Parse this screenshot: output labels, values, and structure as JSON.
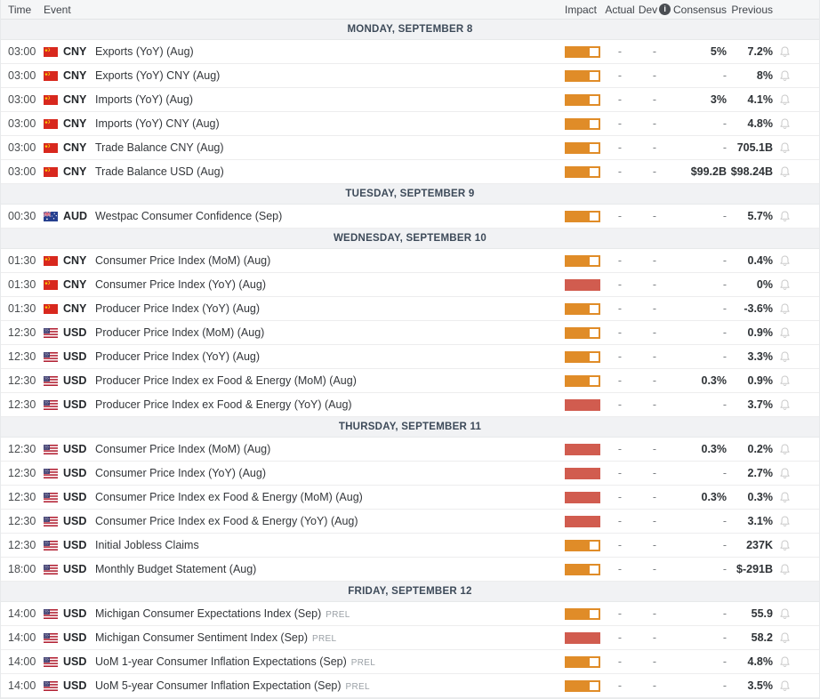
{
  "columns": {
    "time": "Time",
    "event": "Event",
    "impact": "Impact",
    "actual": "Actual",
    "dev": "Dev",
    "consensus": "Consensus",
    "previous": "Previous"
  },
  "colors": {
    "impact_medium": "#e08c28",
    "impact_high": "#d15c4f",
    "day_band_bg": "#f1f2f4",
    "day_band_text": "#3d4a59"
  },
  "sections": [
    {
      "label": "MONDAY, SEPTEMBER 8",
      "rows": [
        {
          "time": "03:00",
          "currency": "CNY",
          "flag": "cn",
          "event": "Exports (YoY) (Aug)",
          "impact": "medium",
          "actual": "-",
          "dev": "-",
          "consensus": "5%",
          "previous": "7.2%"
        },
        {
          "time": "03:00",
          "currency": "CNY",
          "flag": "cn",
          "event": "Exports (YoY) CNY (Aug)",
          "impact": "medium",
          "actual": "-",
          "dev": "-",
          "consensus": "-",
          "previous": "8%"
        },
        {
          "time": "03:00",
          "currency": "CNY",
          "flag": "cn",
          "event": "Imports (YoY) (Aug)",
          "impact": "medium",
          "actual": "-",
          "dev": "-",
          "consensus": "3%",
          "previous": "4.1%"
        },
        {
          "time": "03:00",
          "currency": "CNY",
          "flag": "cn",
          "event": "Imports (YoY) CNY (Aug)",
          "impact": "medium",
          "actual": "-",
          "dev": "-",
          "consensus": "-",
          "previous": "4.8%"
        },
        {
          "time": "03:00",
          "currency": "CNY",
          "flag": "cn",
          "event": "Trade Balance CNY (Aug)",
          "impact": "medium",
          "actual": "-",
          "dev": "-",
          "consensus": "-",
          "previous": "705.1B"
        },
        {
          "time": "03:00",
          "currency": "CNY",
          "flag": "cn",
          "event": "Trade Balance USD (Aug)",
          "impact": "medium",
          "actual": "-",
          "dev": "-",
          "consensus": "$99.2B",
          "previous": "$98.24B"
        }
      ]
    },
    {
      "label": "TUESDAY, SEPTEMBER 9",
      "rows": [
        {
          "time": "00:30",
          "currency": "AUD",
          "flag": "au",
          "event": "Westpac Consumer Confidence (Sep)",
          "impact": "medium",
          "actual": "-",
          "dev": "-",
          "consensus": "-",
          "previous": "5.7%"
        }
      ]
    },
    {
      "label": "WEDNESDAY, SEPTEMBER 10",
      "rows": [
        {
          "time": "01:30",
          "currency": "CNY",
          "flag": "cn",
          "event": "Consumer Price Index (MoM) (Aug)",
          "impact": "medium",
          "actual": "-",
          "dev": "-",
          "consensus": "-",
          "previous": "0.4%"
        },
        {
          "time": "01:30",
          "currency": "CNY",
          "flag": "cn",
          "event": "Consumer Price Index (YoY) (Aug)",
          "impact": "high",
          "actual": "-",
          "dev": "-",
          "consensus": "-",
          "previous": "0%"
        },
        {
          "time": "01:30",
          "currency": "CNY",
          "flag": "cn",
          "event": "Producer Price Index (YoY) (Aug)",
          "impact": "medium",
          "actual": "-",
          "dev": "-",
          "consensus": "-",
          "previous": "-3.6%"
        },
        {
          "time": "12:30",
          "currency": "USD",
          "flag": "us",
          "event": "Producer Price Index (MoM) (Aug)",
          "impact": "medium",
          "actual": "-",
          "dev": "-",
          "consensus": "-",
          "previous": "0.9%"
        },
        {
          "time": "12:30",
          "currency": "USD",
          "flag": "us",
          "event": "Producer Price Index (YoY) (Aug)",
          "impact": "medium",
          "actual": "-",
          "dev": "-",
          "consensus": "-",
          "previous": "3.3%"
        },
        {
          "time": "12:30",
          "currency": "USD",
          "flag": "us",
          "event": "Producer Price Index ex Food & Energy (MoM) (Aug)",
          "impact": "medium",
          "actual": "-",
          "dev": "-",
          "consensus": "0.3%",
          "previous": "0.9%"
        },
        {
          "time": "12:30",
          "currency": "USD",
          "flag": "us",
          "event": "Producer Price Index ex Food & Energy (YoY) (Aug)",
          "impact": "high",
          "actual": "-",
          "dev": "-",
          "consensus": "-",
          "previous": "3.7%"
        }
      ]
    },
    {
      "label": "THURSDAY, SEPTEMBER 11",
      "rows": [
        {
          "time": "12:30",
          "currency": "USD",
          "flag": "us",
          "event": "Consumer Price Index (MoM) (Aug)",
          "impact": "high",
          "actual": "-",
          "dev": "-",
          "consensus": "0.3%",
          "previous": "0.2%"
        },
        {
          "time": "12:30",
          "currency": "USD",
          "flag": "us",
          "event": "Consumer Price Index (YoY) (Aug)",
          "impact": "high",
          "actual": "-",
          "dev": "-",
          "consensus": "-",
          "previous": "2.7%"
        },
        {
          "time": "12:30",
          "currency": "USD",
          "flag": "us",
          "event": "Consumer Price Index ex Food & Energy (MoM) (Aug)",
          "impact": "high",
          "actual": "-",
          "dev": "-",
          "consensus": "0.3%",
          "previous": "0.3%"
        },
        {
          "time": "12:30",
          "currency": "USD",
          "flag": "us",
          "event": "Consumer Price Index ex Food & Energy (YoY) (Aug)",
          "impact": "high",
          "actual": "-",
          "dev": "-",
          "consensus": "-",
          "previous": "3.1%"
        },
        {
          "time": "12:30",
          "currency": "USD",
          "flag": "us",
          "event": "Initial Jobless Claims",
          "impact": "medium",
          "actual": "-",
          "dev": "-",
          "consensus": "-",
          "previous": "237K"
        },
        {
          "time": "18:00",
          "currency": "USD",
          "flag": "us",
          "event": "Monthly Budget Statement (Aug)",
          "impact": "medium",
          "actual": "-",
          "dev": "-",
          "consensus": "-",
          "previous": "$-291B"
        }
      ]
    },
    {
      "label": "FRIDAY, SEPTEMBER 12",
      "rows": [
        {
          "time": "14:00",
          "currency": "USD",
          "flag": "us",
          "event": "Michigan Consumer Expectations Index (Sep)",
          "prel": "PREL",
          "impact": "medium",
          "actual": "-",
          "dev": "-",
          "consensus": "-",
          "previous": "55.9"
        },
        {
          "time": "14:00",
          "currency": "USD",
          "flag": "us",
          "event": "Michigan Consumer Sentiment Index (Sep)",
          "prel": "PREL",
          "impact": "high",
          "actual": "-",
          "dev": "-",
          "consensus": "-",
          "previous": "58.2"
        },
        {
          "time": "14:00",
          "currency": "USD",
          "flag": "us",
          "event": "UoM 1-year Consumer Inflation Expectations (Sep)",
          "prel": "PREL",
          "impact": "medium",
          "actual": "-",
          "dev": "-",
          "consensus": "-",
          "previous": "4.8%"
        },
        {
          "time": "14:00",
          "currency": "USD",
          "flag": "us",
          "event": "UoM 5-year Consumer Inflation Expectation (Sep)",
          "prel": "PREL",
          "impact": "medium",
          "actual": "-",
          "dev": "-",
          "consensus": "-",
          "previous": "3.5%"
        }
      ]
    }
  ]
}
